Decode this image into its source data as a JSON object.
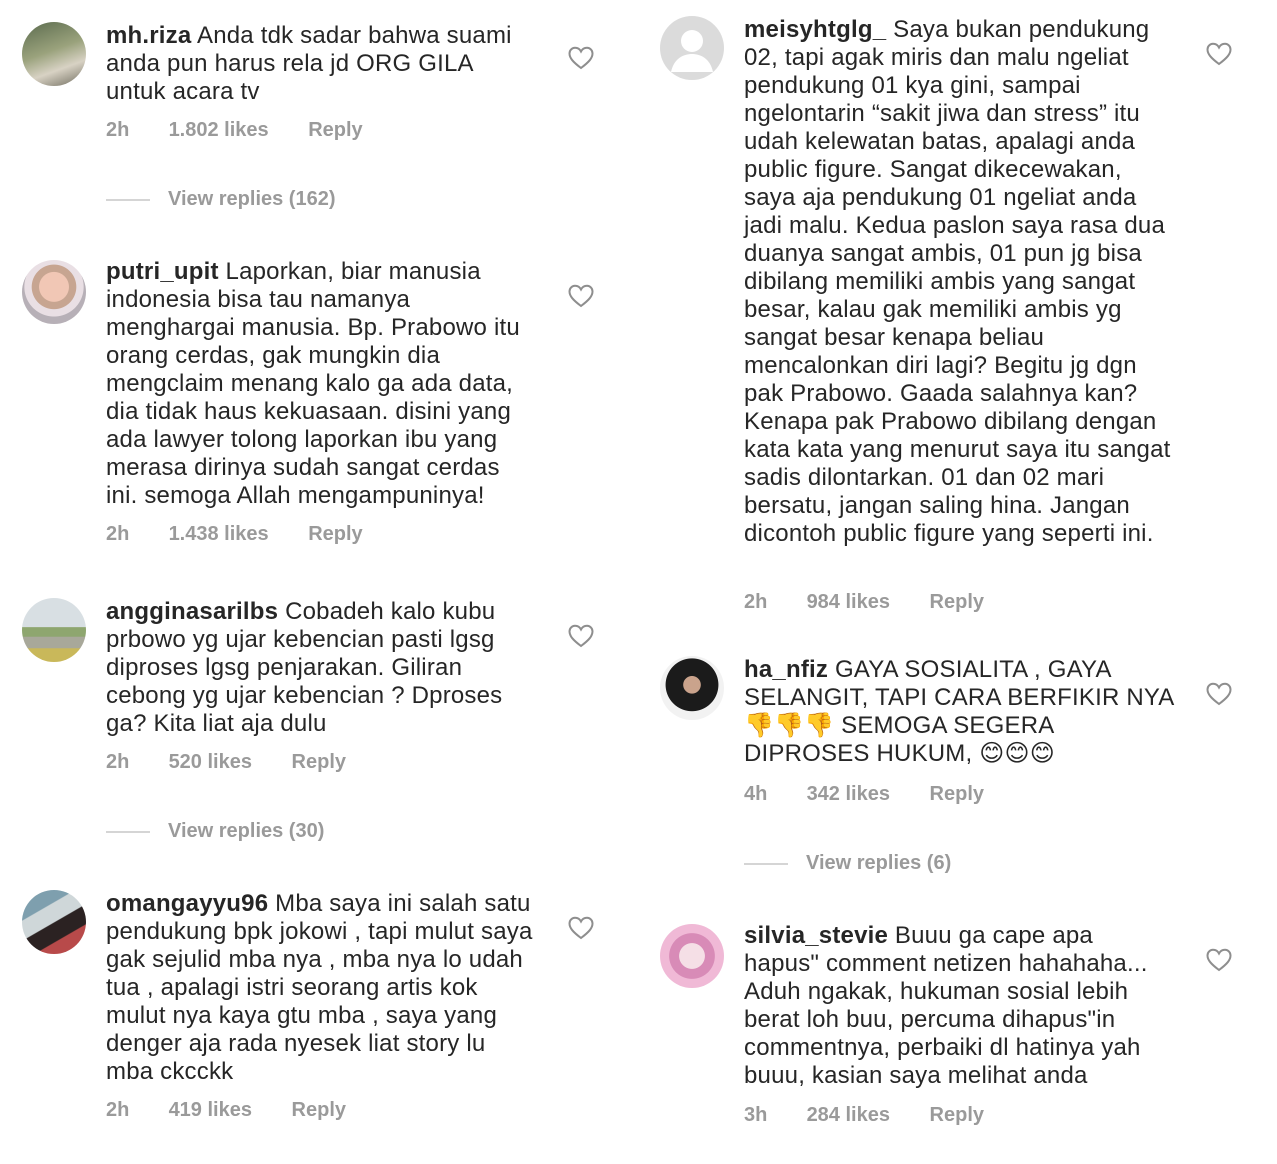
{
  "comments": [
    {
      "username": "mh.riza",
      "text": "Anda tdk sadar bahwa suami anda pun harus rela jd ORG GILA untuk acara tv",
      "time": "2h",
      "likes": "1.802 likes",
      "reply": "Reply",
      "view_replies": "View replies (162)"
    },
    {
      "username": "putri_upit",
      "text": "Laporkan, biar manusia indonesia bisa tau namanya menghargai manusia. Bp. Prabowo itu orang cerdas, gak mungkin dia mengclaim menang kalo ga ada data, dia tidak haus kekuasaan. disini yang ada lawyer tolong laporkan ibu yang merasa dirinya sudah sangat cerdas ini. semoga Allah mengampuninya!",
      "time": "2h",
      "likes": "1.438 likes",
      "reply": "Reply"
    },
    {
      "username": "angginasarilbs",
      "text": "Cobadeh kalo kubu prbowo yg ujar kebencian pasti lgsg diproses lgsg  penjarakan. Giliran cebong yg ujar kebencian ? Dproses ga? Kita liat aja dulu",
      "time": "2h",
      "likes": "520 likes",
      "reply": "Reply",
      "view_replies": "View replies (30)"
    },
    {
      "username": "omangayyu96",
      "text": "Mba saya ini salah satu pendukung bpk jokowi , tapi mulut saya gak sejulid mba nya , mba nya lo udah tua , apalagi istri seorang artis kok mulut nya kaya gtu mba , saya yang denger aja rada nyesek liat story lu mba ckcckk",
      "time": "2h",
      "likes": "419 likes",
      "reply": "Reply"
    },
    {
      "username": "meisyhtglg_",
      "text": "Saya bukan pendukung 02, tapi agak miris dan malu ngeliat pendukung 01 kya gini, sampai ngelontarin “sakit jiwa dan stress” itu udah kelewatan batas, apalagi anda public figure. Sangat dikecewakan, saya aja pendukung 01 ngeliat anda jadi malu. Kedua paslon saya rasa dua duanya sangat ambis, 01 pun jg bisa dibilang memiliki ambis yang sangat besar, kalau gak memiliki ambis yg sangat besar kenapa beliau mencalonkan diri lagi? Begitu jg dgn pak Prabowo. Gaada salahnya kan? Kenapa pak Prabowo dibilang dengan kata kata yang menurut saya itu sangat sadis dilontarkan. 01 dan 02 mari bersatu, jangan saling hina. Jangan dicontoh public figure yang seperti ini.",
      "time": "2h",
      "likes": "984 likes",
      "reply": "Reply"
    },
    {
      "username": "ha_nfiz",
      "text_a": "GAYA SOSIALITA , GAYA SELANGIT, TAPI CARA BERFIKIR NYA",
      "emoji_a": "👎👎👎",
      "text_b": "SEMOGA SEGERA DIPROSES HUKUM,",
      "emoji_b": "😊😊😊",
      "time": "4h",
      "likes": "342 likes",
      "reply": "Reply",
      "view_replies": "View replies (6)"
    },
    {
      "username": "silvia_stevie",
      "text": "Buuu ga cape apa hapus\" comment netizen hahahaha... Aduh ngakak, hukuman sosial lebih berat loh buu, percuma dihapus\"in commentnya, perbaiki dl hatinya yah buuu, kasian saya melihat anda",
      "time": "3h",
      "likes": "284 likes",
      "reply": "Reply"
    }
  ],
  "colors": {
    "text": "#262626",
    "meta": "#9a9a9a",
    "line": "#d5d5d5"
  }
}
